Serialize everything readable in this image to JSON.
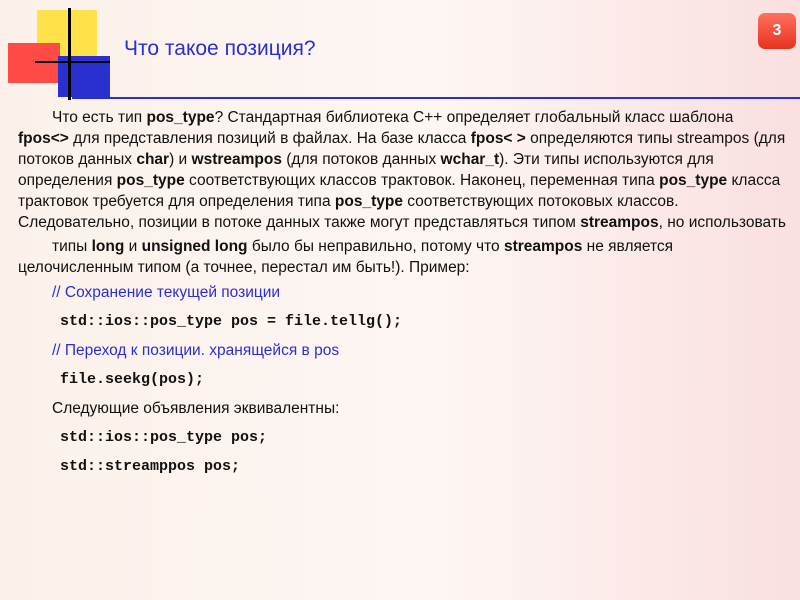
{
  "slide": {
    "number": "3",
    "title": "Что такое позиция?"
  },
  "paragraph1": {
    "t0": "Что есть тип ",
    "b0": "pos_type",
    "t1": "? Стандартная библиотека С++ определяет глобальный класс шаблона ",
    "b1": "fpos<>",
    "t2": " для представления позиций в файлах. На базе класса ",
    "b2": "fpos< >",
    "t3": " определяются типы streampos (для потоков данных ",
    "b3": "char",
    "t4": ") и ",
    "b4": "wstreampos",
    "t5": " (для потоков данных ",
    "b5": "wchar_t",
    "t6": "). Эти типы используются для определения ",
    "b6": "pos_type",
    "t7": " соответствующих классов трактовок. Наконец, переменная типа ",
    "b7": "pos_type",
    "t8": " класса трактовок требуется для определения типа ",
    "b8": "pos_type",
    "t9": " соответствующих потоковых классов. Следовательно, позиции в потоке данных также могут представляться типом ",
    "b9": "streampos",
    "t10": ", но использовать"
  },
  "paragraph2": {
    "t0": "типы ",
    "b0": "long",
    "t1": " и ",
    "b1": "unsigned long",
    "t2": " было бы неправильно, потому что ",
    "b2": "streampos",
    "t3": " не является целочисленным типом (а точнее, перестал им быть!). Пример:"
  },
  "lines": [
    "// Сохранение текущей позиции",
    "std::ios::pos_type  pos = file.tellg();",
    "// Переход к позиции. хранящейся в pos",
    "file.seekg(pos);",
    "Следующие объявления эквивалентны:",
    "std::ios::pos_type pos;",
    "std::streamppos pos;"
  ],
  "colors": {
    "accent": "#2a2fcf",
    "badge": "#e8311f",
    "deco_yellow": "#ffe24a",
    "deco_red": "#ff4a46",
    "deco_blue": "#2a2fcf"
  }
}
